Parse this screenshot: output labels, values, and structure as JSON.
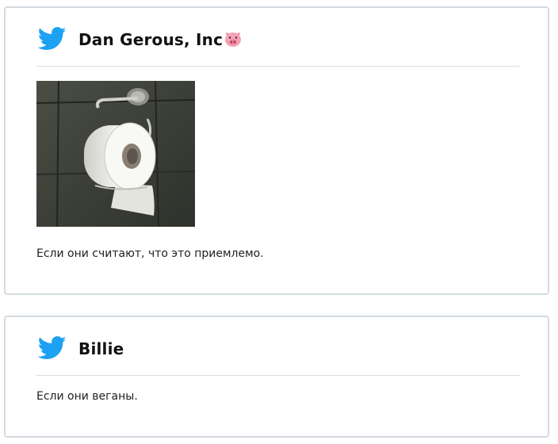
{
  "colors": {
    "twitter_blue": "#1da1f2",
    "card_border": "#d4dbe0",
    "divider": "#d5dde2"
  },
  "tweets": [
    {
      "icon": "twitter-bird-icon",
      "author": "Dan Gerous, Inc",
      "author_emoji": "pig-face-icon",
      "image": "toilet-paper-roll-photo",
      "text": "Если они считают, что это приемлемо."
    },
    {
      "icon": "twitter-bird-icon",
      "author": "Billie",
      "text": "Если они веганы."
    }
  ]
}
